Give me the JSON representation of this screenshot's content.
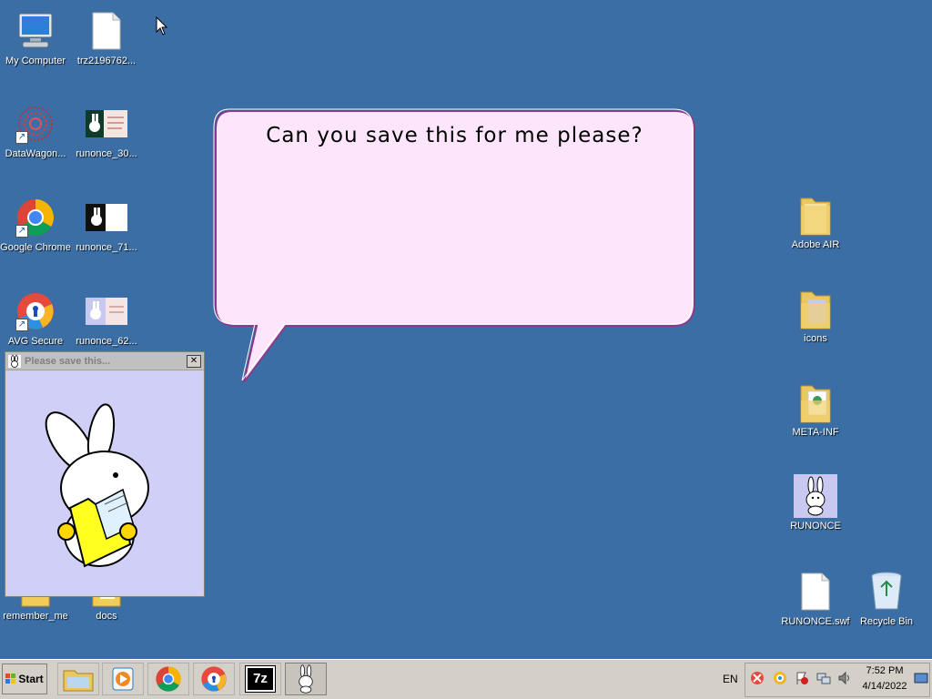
{
  "desktop": {
    "icons_left": [
      {
        "label": "My Computer",
        "icon": "computer-icon"
      },
      {
        "label": "trz2196762...",
        "icon": "file-icon"
      },
      {
        "label": "DataWagon...",
        "icon": "datawagon-icon"
      },
      {
        "label": "runonce_30...",
        "icon": "image-thumb-icon"
      },
      {
        "label": "Google Chrome",
        "icon": "chrome-icon"
      },
      {
        "label": "runonce_71...",
        "icon": "image-thumb-icon"
      },
      {
        "label": "AVG Secure",
        "icon": "avg-icon"
      },
      {
        "label": "runonce_62...",
        "icon": "image-thumb-icon"
      },
      {
        "label": "remember_me",
        "icon": "folder-icon"
      },
      {
        "label": "docs",
        "icon": "folder-icon"
      }
    ],
    "icons_right": [
      {
        "label": "Adobe AIR",
        "icon": "folder-icon"
      },
      {
        "label": "icons",
        "icon": "folder-icon"
      },
      {
        "label": "META-INF",
        "icon": "folder-icon"
      },
      {
        "label": "RUNONCE",
        "icon": "bunny-app-icon"
      },
      {
        "label": "RUNONCE.swf",
        "icon": "file-icon"
      },
      {
        "label": "Recycle Bin",
        "icon": "recycle-bin-icon"
      }
    ]
  },
  "bubble": {
    "text": "Can you save this for me please?"
  },
  "mini_window": {
    "title": "Please save this...",
    "close": "✕"
  },
  "taskbar": {
    "start_label": "Start",
    "apps": [
      "file-explorer-icon",
      "media-player-icon",
      "chrome-icon",
      "avg-icon",
      "7zip-icon",
      "bunny-app-icon"
    ],
    "language": "EN",
    "time": "7:52 PM",
    "date": "4/14/2022",
    "sevenzip_label": "7z"
  },
  "colors": {
    "desktop": "#3a6ea5",
    "bubble_fill": "#fde6fb",
    "window_bg": "#cfcff7"
  }
}
